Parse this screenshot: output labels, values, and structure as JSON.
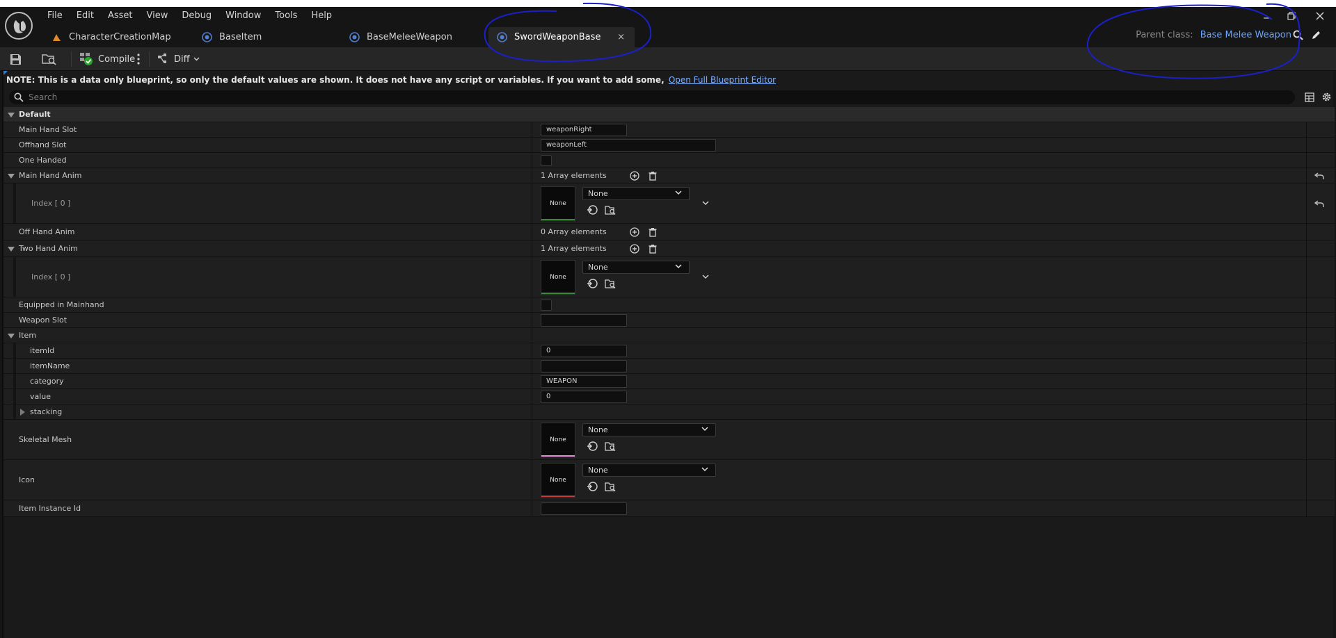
{
  "menu": [
    "File",
    "Edit",
    "Asset",
    "View",
    "Debug",
    "Window",
    "Tools",
    "Help"
  ],
  "tabs": [
    {
      "label": "CharacterCreationMap",
      "icon": "map-icon",
      "active": false
    },
    {
      "label": "BaseItem",
      "icon": "blueprint-icon",
      "active": false
    },
    {
      "label": "BaseMeleeWeapon",
      "icon": "blueprint-icon",
      "active": false
    },
    {
      "label": "SwordWeaponBase",
      "icon": "blueprint-icon",
      "active": true
    }
  ],
  "tab_close": "×",
  "parent_class": {
    "label": "Parent class:",
    "value": "Base Melee Weapon"
  },
  "toolbar": {
    "compile_label": "Compile",
    "diff_label": "Diff"
  },
  "note": {
    "text": "NOTE: This is a data only blueprint, so only the default values are shown.  It does not have any script or variables.  If you want to add some,",
    "link": "Open Full Blueprint Editor"
  },
  "search": {
    "placeholder": "Search"
  },
  "details": {
    "default_header": "Default",
    "main_hand_slot": {
      "label": "Main Hand Slot",
      "value": "weaponRight"
    },
    "offhand_slot": {
      "label": "Offhand Slot",
      "value": "weaponLeft"
    },
    "one_handed": {
      "label": "One Handed",
      "checked": false
    },
    "main_hand_anim": {
      "label": "Main Hand Anim",
      "count": "1 Array elements",
      "index": "Index [ 0 ]",
      "thumb": "None",
      "combo": "None"
    },
    "off_hand_anim": {
      "label": "Off Hand Anim",
      "count": "0 Array elements"
    },
    "two_hand_anim": {
      "label": "Two Hand Anim",
      "count": "1 Array elements",
      "index": "Index [ 0 ]",
      "thumb": "None",
      "combo": "None"
    },
    "equipped_in_mainhand": {
      "label": "Equipped in Mainhand",
      "checked": false
    },
    "weapon_slot": {
      "label": "Weapon Slot",
      "value": ""
    },
    "item": {
      "label": "Item",
      "item_id": {
        "label": "itemId",
        "value": "0"
      },
      "item_name": {
        "label": "itemName",
        "value": ""
      },
      "category": {
        "label": "category",
        "value": "WEAPON"
      },
      "value": {
        "label": "value",
        "value": "0"
      },
      "stacking": {
        "label": "stacking"
      }
    },
    "skeletal_mesh": {
      "label": "Skeletal Mesh",
      "thumb": "None",
      "combo": "None"
    },
    "icon": {
      "label": "Icon",
      "thumb": "None",
      "combo": "None"
    },
    "item_instance_id": {
      "label": "Item Instance Id",
      "value": ""
    }
  },
  "colors": {
    "background": "#151515",
    "panel": "#1f1f1f",
    "accent_link": "#6aa5ff",
    "anim_underline": "#3a8a3a",
    "mesh_underline": "#e08ad8",
    "icon_underline": "#c83a3a",
    "annotation": "#1a20c8"
  }
}
